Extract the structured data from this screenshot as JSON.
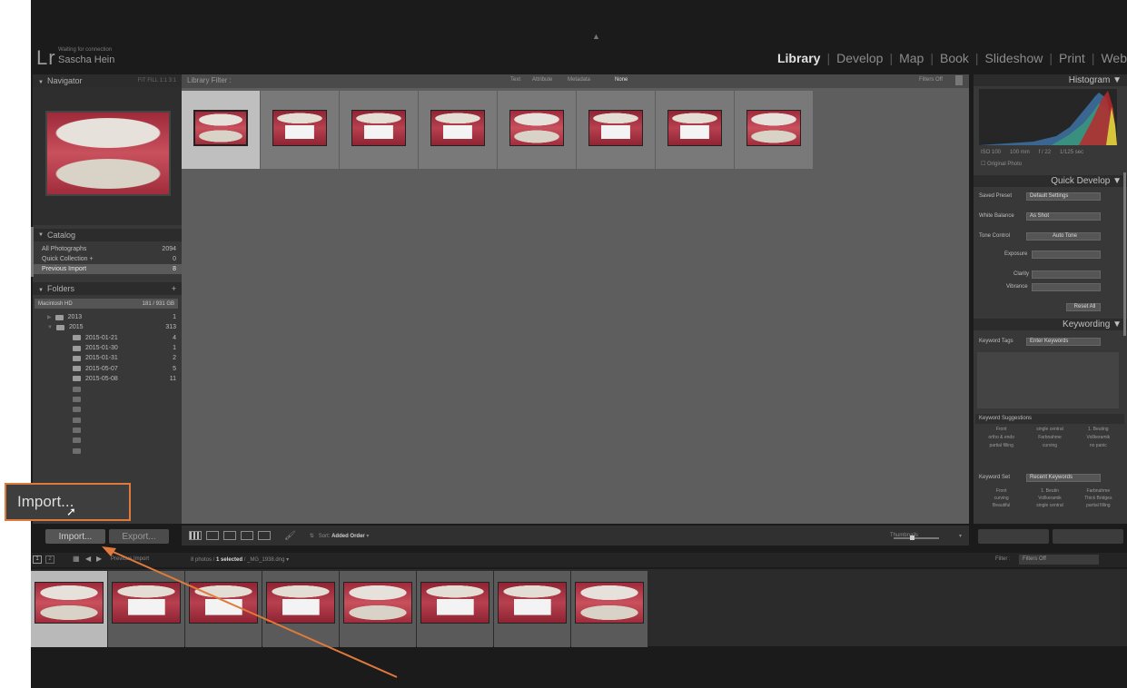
{
  "identity": {
    "logo": "Lr",
    "status": "Waiting for connection",
    "name": "Sascha Hein"
  },
  "modules": [
    "Library",
    "Develop",
    "Map",
    "Book",
    "Slideshow",
    "Print",
    "Web"
  ],
  "active_module": "Library",
  "left": {
    "navigator_label": "Navigator",
    "navigator_zoom": "FIT  FILL  1:1  3:1",
    "catalog_label": "Catalog",
    "catalog_items": [
      {
        "label": "All Photographs",
        "count": "2094"
      },
      {
        "label": "Quick Collection +",
        "count": "0"
      },
      {
        "label": "Previous Import",
        "count": "8"
      }
    ],
    "folders_label": "Folders",
    "drive": {
      "label": "Macintosh HD",
      "size": "181 / 931 GB"
    },
    "folders": [
      {
        "name": "2013",
        "count": "1"
      },
      {
        "name": "2015",
        "count": "313"
      },
      {
        "name": "2015-01-21",
        "count": "4"
      },
      {
        "name": "2015-01-30",
        "count": "1"
      },
      {
        "name": "2015-01-31",
        "count": "2"
      },
      {
        "name": "2015-05-07",
        "count": "5"
      },
      {
        "name": "2015-05-08",
        "count": "11"
      }
    ],
    "import_button": "Import...",
    "export_button": "Export..."
  },
  "library_filter": {
    "label": "Library Filter :",
    "options": [
      "Text",
      "Attribute",
      "Metadata",
      "None"
    ],
    "active": "None",
    "preset": "Filters Off"
  },
  "toolbar": {
    "sort_label": "Sort:",
    "sort_value": "Added Order",
    "thumbnails_label": "Thumbnails"
  },
  "filmstrip": {
    "pages": [
      "1",
      "2"
    ],
    "source": "Previous Import",
    "info_count": "8 photos /",
    "info_selected": "1 selected",
    "info_file": "/ _MG_1938.dng",
    "filter_label": "Filter :",
    "filter_value": "Filters Off"
  },
  "right": {
    "histogram_label": "Histogram",
    "histogram_meta": [
      "ISO 100",
      "100 mm",
      "f / 22",
      "1/125 sec"
    ],
    "original_photo": "Original Photo",
    "quick_develop_label": "Quick Develop",
    "saved_preset_label": "Saved Preset",
    "saved_preset_value": "Default Settings",
    "white_balance_label": "White Balance",
    "white_balance_value": "As Shot",
    "tone_control_label": "Tone Control",
    "auto_tone": "Auto Tone",
    "exposure_label": "Exposure",
    "clarity_label": "Clarity",
    "vibrance_label": "Vibrance",
    "reset_all": "Reset All",
    "keywording_label": "Keywording",
    "keyword_tags_label": "Keyword Tags",
    "keyword_tags_value": "Enter Keywords",
    "keyword_suggestions_label": "Keyword Suggestions",
    "suggestions": [
      "Front",
      "single central",
      "1. Beuting",
      "ortho & endo",
      "Farbnahme",
      "Vollkeramik",
      "partial filling",
      "curving",
      "no panic"
    ],
    "keyword_set_label": "Keyword Set",
    "keyword_set_value": "Recent Keywords",
    "keyword_set_items": [
      "Front",
      "1. Beutin",
      "Farbnahme",
      "curving",
      "Vollkeramik",
      "Thick Bridges",
      "Beautiful",
      "single central",
      "partial filling"
    ]
  },
  "callout": {
    "label": "Import..."
  },
  "colors": {
    "accent": "#e07a3c",
    "panel": "#383838",
    "grid": "#5e5e5e"
  }
}
